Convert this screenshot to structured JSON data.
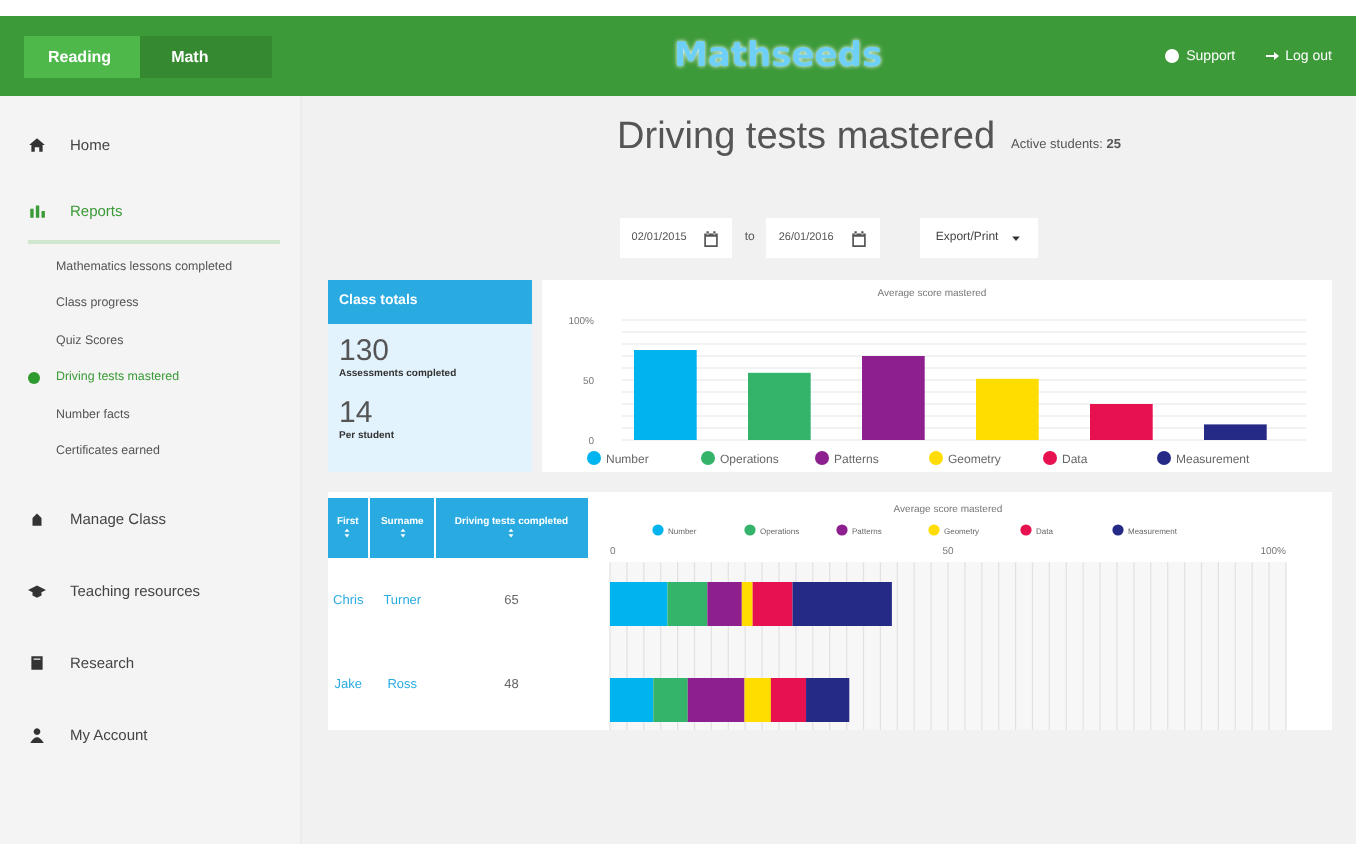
{
  "header": {
    "tabs": [
      {
        "label": "Reading",
        "selected": true
      },
      {
        "label": "Math",
        "selected": false
      }
    ],
    "logo": "Mathseeds",
    "links": [
      {
        "label": "Support"
      },
      {
        "label": "Log out"
      }
    ]
  },
  "sidebar": {
    "items": [
      {
        "label": "Home",
        "selected": false
      },
      {
        "label": "Reports",
        "selected": true,
        "expanded": true,
        "children": [
          {
            "label": "Mathematics lessons completed",
            "selected": false
          },
          {
            "label": "Class progress",
            "selected": false
          },
          {
            "label": "Quiz Scores",
            "selected": false
          },
          {
            "label": "Driving tests mastered",
            "selected": true
          },
          {
            "label": "Number facts",
            "selected": false
          },
          {
            "label": "Certificates earned",
            "selected": false
          }
        ]
      },
      {
        "label": "Manage Class",
        "selected": false
      },
      {
        "label": "Teaching resources",
        "selected": false
      },
      {
        "label": "Research",
        "selected": false
      },
      {
        "label": "My Account",
        "selected": false
      }
    ]
  },
  "page": {
    "title": "Driving tests mastered",
    "active_label": "Active students:",
    "active_count": "25"
  },
  "filters": {
    "from": "02/01/2015",
    "to_label": "to",
    "to": "26/01/2016",
    "export": "Export/Print"
  },
  "class_totals": {
    "title": "Class totals",
    "stats": [
      {
        "value": "130",
        "label": "Assessments completed"
      },
      {
        "value": "14",
        "label": "Per student"
      }
    ]
  },
  "bar_chart": {
    "chart_data": {
      "type": "bar",
      "title": "Average score mastered",
      "legend": "bottom",
      "ylim": [
        0,
        100
      ],
      "yticks": [
        {
          "value": 0,
          "label": "0"
        },
        {
          "value": 50,
          "label": "50"
        },
        {
          "value": 100,
          "label": "100%"
        }
      ],
      "series": [
        {
          "name": "Number",
          "color": "#00b4ef",
          "values": [
            75
          ]
        },
        {
          "name": "Operations",
          "color": "#34b36a",
          "values": [
            56
          ]
        },
        {
          "name": "Patterns",
          "color": "#8e1f8f",
          "values": [
            70
          ]
        },
        {
          "name": "Geometry",
          "color": "#ffdd00",
          "values": [
            51
          ]
        },
        {
          "name": "Data",
          "color": "#e8114f",
          "values": [
            30
          ]
        },
        {
          "name": "Measurement",
          "color": "#262a87",
          "values": [
            13
          ]
        }
      ]
    }
  },
  "students": {
    "columns": [
      "First",
      "Surname",
      "Driving tests completed"
    ],
    "rows": [
      [
        "Chris",
        "Turner",
        "65"
      ],
      [
        "Jake",
        "Ross",
        "48"
      ]
    ]
  },
  "stacked_chart": {
    "chart_data": {
      "type": "bar",
      "orientation": "horizontal",
      "stacked": true,
      "title": "Average score mastered",
      "legend": "top",
      "xlim": [
        0,
        100
      ],
      "xticks": [
        {
          "value": 0,
          "label": "0"
        },
        {
          "value": 50,
          "label": "50"
        },
        {
          "value": 100,
          "label": "100%"
        }
      ],
      "series": [
        {
          "name": "Number",
          "color": "#00b4ef",
          "values": [
            8.5,
            6.4
          ]
        },
        {
          "name": "Operations",
          "color": "#34b36a",
          "values": [
            5.9,
            5.1
          ]
        },
        {
          "name": "Patterns",
          "color": "#8e1f8f",
          "values": [
            5.1,
            8.4
          ]
        },
        {
          "name": "Geometry",
          "color": "#ffdd00",
          "values": [
            1.6,
            3.9
          ]
        },
        {
          "name": "Data",
          "color": "#e8114f",
          "values": [
            5.9,
            5.2
          ]
        },
        {
          "name": "Measurement",
          "color": "#262a87",
          "values": [
            14.7,
            6.4
          ]
        }
      ]
    }
  }
}
